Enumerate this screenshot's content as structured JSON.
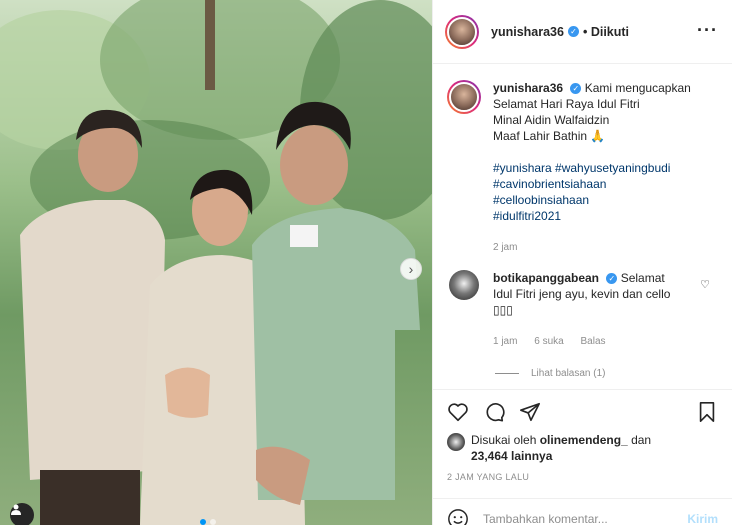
{
  "post": {
    "username": "yunishara36",
    "follow_status": "Diikuti",
    "more_icon": "more-horizontal-icon"
  },
  "caption": {
    "username": "yunishara36",
    "lines": [
      "Kami mengucapkan",
      "Selamat Hari Raya Idul Fitri",
      "Minal Aidin Walfaidzin",
      "Maaf Lahir Bathin 🙏"
    ],
    "hashtags": [
      "#yunishara #wahyusetyaningbudi",
      "#cavinobrientsiahaan",
      "#celloobinsiahaan",
      "#idulfitri2021"
    ],
    "time": "2 jam"
  },
  "comment": {
    "username": "botikapanggabean",
    "text_line1": "Selamat",
    "text_line2": "Idul Fitri jeng ayu, kevin dan cello",
    "text_line3": "▯▯▯",
    "time": "1 jam",
    "likes": "6 suka",
    "reply": "Balas",
    "view_replies": "Lihat balasan (1)"
  },
  "actions": {
    "liked_by_prefix": "Disukai oleh",
    "liked_by_user": "olinemendeng_",
    "liked_by_and": "dan",
    "others": "23,464 lainnya",
    "timestamp": "2 JAM YANG LALU"
  },
  "add_comment": {
    "placeholder": "Tambahkan komentar...",
    "send": "Kirim"
  },
  "colors": {
    "verified": "#3897f0",
    "hashtag": "#00376b",
    "muted": "#8e8e8e",
    "send_disabled": "#b2dffc"
  }
}
